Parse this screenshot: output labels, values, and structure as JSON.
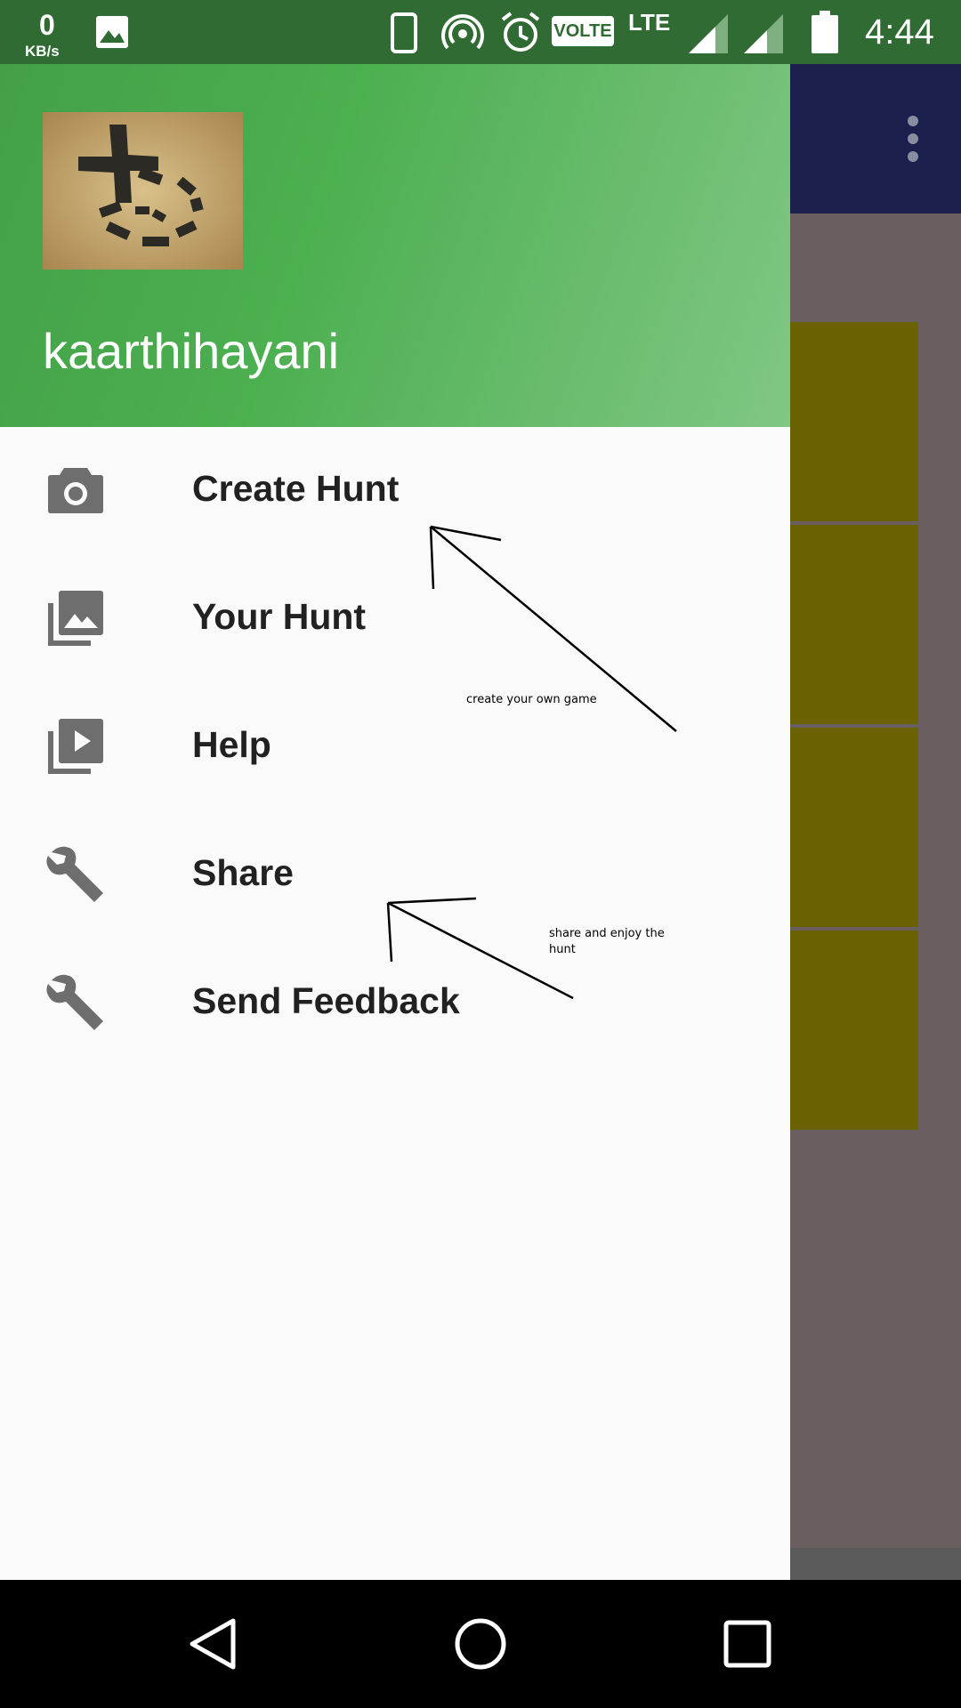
{
  "status_bar": {
    "network_speed_value": "0",
    "network_speed_unit": "KB/s",
    "volte_label": "VOLTE",
    "lte_label": "LTE",
    "time": "4:44",
    "icons": [
      "image-icon",
      "phone-icon",
      "hotspot-icon",
      "alarm-icon",
      "signal-icon",
      "signal-icon",
      "battery-icon"
    ]
  },
  "drawer": {
    "username": "kaarthihayani",
    "menu": [
      {
        "label": "Create Hunt",
        "icon": "camera-icon"
      },
      {
        "label": "Your Hunt",
        "icon": "photo-library-icon"
      },
      {
        "label": "Help",
        "icon": "video-library-icon"
      },
      {
        "label": "Share",
        "icon": "wrench-icon"
      },
      {
        "label": "Send Feedback",
        "icon": "wrench-icon"
      }
    ]
  },
  "annotations": {
    "create_note": "create your own game",
    "share_note_line1": "share and enjoy the",
    "share_note_line2": "hunt"
  },
  "colors": {
    "drawer_header_start": "#43a047",
    "drawer_header_end": "#81c784",
    "status_bar": "#2f6b32",
    "app_toolbar": "#1a1f4e",
    "app_tile": "#6a6200"
  },
  "nav": {
    "back": "back-icon",
    "home": "home-icon",
    "recents": "recents-icon"
  }
}
